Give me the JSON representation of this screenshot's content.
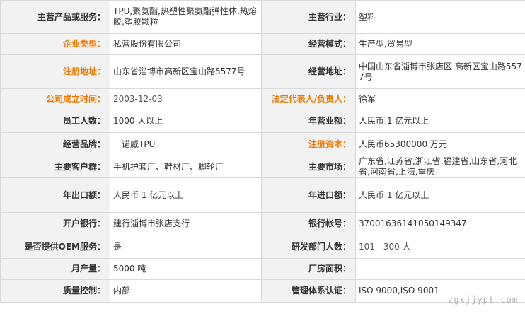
{
  "rows": [
    {
      "l1": "主营产品或服务：",
      "v1": "TPU,聚氨酯,热塑性聚氨酯弹性体,热熔胶,塑胶颗粒",
      "l2": "主营行业：",
      "v2": "塑料"
    },
    {
      "l1": "企业类型：",
      "v1": "私营股份有限公司",
      "l2": "经营模式：",
      "v2": "生产型,贸易型"
    },
    {
      "l1": "注册地址：",
      "v1": "山东省淄博市高新区宝山路5577号",
      "l2": "经营地址：",
      "v2": "中国山东省淄博市张店区 高新区宝山路5577号"
    },
    {
      "l1": "公司成立时间：",
      "v1": "2003-12-03",
      "l2": "法定代表人/负责人：",
      "v2": "徐军"
    },
    {
      "l1": "员工人数：",
      "v1": "1000 人以上",
      "l2": "年营业额：",
      "v2": "人民币 1 亿元以上"
    },
    {
      "l1": "经营品牌：",
      "v1": "一诺威TPU",
      "l2": "注册资本：",
      "v2": "人民币65300000 万元"
    },
    {
      "l1": "主要客户群：",
      "v1": "手机护套厂、鞋材厂、脚轮厂",
      "l2": "主要市场：",
      "v2": "广东省,江苏省,浙江省,福建省,山东省,河北省,河南省,上海,重庆"
    },
    {
      "l1": "年出口额：",
      "v1": "人民币 1 亿元以上",
      "l2": "年进口额：",
      "v2": "人民币 1 亿元以上"
    },
    {
      "l1": "开户银行：",
      "v1": "建行淄博市张店支行",
      "l2": "银行帐号：",
      "v2": "37001636141050149347"
    },
    {
      "l1": "是否提供OEM服务：",
      "v1": "是",
      "l2": "研发部门人数：",
      "v2": "101 - 300 人"
    },
    {
      "l1": "月产量：",
      "v1": "5000 吨",
      "l2": "厂房面积：",
      "v2": "—"
    },
    {
      "l1": "质量控制：",
      "v1": "内部",
      "l2": "管理体系认证：",
      "v2": "ISO 9000,ISO 9001"
    }
  ],
  "watermark": "zgxjjypt.com",
  "colors": {
    "highlight_label": "#ee7700",
    "label_bg": "#f2f2f2",
    "border": "#d9d9d9"
  }
}
